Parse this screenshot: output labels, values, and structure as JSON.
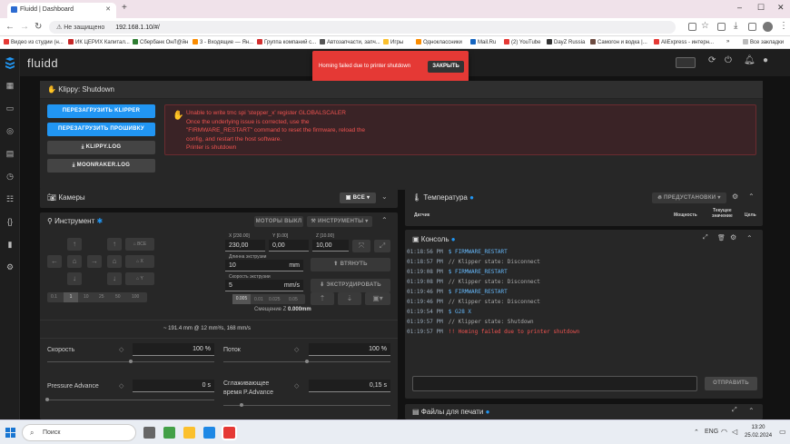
{
  "browser": {
    "tab_title": "Fluidd | Dashboard",
    "not_secure": "Не защищено",
    "url": "192.168.1.10/#/",
    "bookmarks": [
      {
        "label": "Видео из студии (н...",
        "color": "#e53935"
      },
      {
        "label": "ИК ЦЕРИХ Капитал...",
        "color": "#c62828"
      },
      {
        "label": "Сбербанк ОнЛ@йн",
        "color": "#2e7d32"
      },
      {
        "label": "3 - Входящие — Ян...",
        "color": "#fb8c00"
      },
      {
        "label": "Группа компаний с...",
        "color": "#d32f2f"
      },
      {
        "label": "Автозапчасти, запч...",
        "color": "#555"
      },
      {
        "label": "Игры",
        "color": "#fbc02d"
      },
      {
        "label": "Одноклассники",
        "color": "#fb8c00"
      },
      {
        "label": "Mail.Ru",
        "color": "#1565c0"
      },
      {
        "label": "(2) YouTube",
        "color": "#e53935"
      },
      {
        "label": "DayZ Russia",
        "color": "#333"
      },
      {
        "label": "Самогон и водка |...",
        "color": "#6d4c41"
      },
      {
        "label": "AliExpress - интерн...",
        "color": "#e53935"
      }
    ],
    "all_bookmarks": "Все закладки",
    "more": "»"
  },
  "app": {
    "brand": "fluidd",
    "accent": "#2196f3",
    "toast": {
      "message": "Homing failed due to printer shutdown",
      "close": "ЗАКРЫТЬ",
      "color": "#e53935"
    }
  },
  "klippy": {
    "title": "Klippy: Shutdown",
    "buttons": [
      "ПЕРЕЗАГРУЗИТЬ KLIPPER",
      "ПЕРЕЗАГРУЗИТЬ ПРОШИВКУ",
      "KLIPPY.LOG",
      "MOONRAKER.LOG"
    ],
    "error_lines": [
      "Unable to write tmc spi 'stepper_x' register GLOBALSCALER",
      "Once the underlying issue is corrected, use the",
      "\"FIRMWARE_RESTART\" command to reset the firmware, reload the",
      "config, and restart the host software.",
      "Printer is shutdown"
    ]
  },
  "cameras": {
    "title": "Камеры",
    "filter": "ВСЕ"
  },
  "tool": {
    "title": "Инструмент",
    "motors_off": "МОТОРЫ ВЫКЛ",
    "tools_menu": "ИНСТРУМЕНТЫ",
    "jog_all": "ВСЕ",
    "jog_x": "X",
    "jog_y": "Y",
    "steps": [
      "0.1",
      "1",
      "10",
      "25",
      "50",
      "100"
    ],
    "z_steps": [
      "0.005",
      "0.01",
      "0.025",
      "0.05"
    ],
    "x_label": "X [230.00]",
    "x_value": "230,00",
    "y_label": "Y [0.00]",
    "y_value": "0,00",
    "z_label": "Z [10.00]",
    "z_value": "10,00",
    "extrude_len_label": "Длинна экструзии",
    "extrude_len": "10",
    "extrude_len_unit": "mm",
    "extrude_speed_label": "Скорость экструзии",
    "extrude_speed": "5",
    "extrude_speed_unit": "mm/s",
    "retract": "ВТЯНУТЬ",
    "extrude": "ЭКСТРУДИРОВАТЬ",
    "z_offset_label": "Смещение Z",
    "z_offset": "0.000mm",
    "flow_summary": "~ 191.4 mm @ 12 mm³/s, 168 mm/s",
    "speed_label": "Скорость",
    "speed_value": "100 %",
    "flow_label": "Поток",
    "flow_value": "100 %",
    "pa_label": "Pressure Advance",
    "pa_value": "0 s",
    "smooth_label_1": "Сглаживающее",
    "smooth_label_2": "время P.Advance",
    "smooth_value": "0,15 s"
  },
  "temperature": {
    "title": "Температура",
    "presets": "ПРЕДУСТАНОВКИ",
    "col_sensor": "Датчик",
    "col_power": "Мощность",
    "col_current_1": "Текущее",
    "col_current_2": "значение",
    "col_target": "Цель"
  },
  "console": {
    "title": "Консоль",
    "send": "ОТПРАВИТЬ",
    "lines": [
      {
        "time": "01:18:56 PM",
        "text": "$ FIRMWARE_RESTART",
        "kind": "cmd"
      },
      {
        "time": "01:18:57 PM",
        "text": "// Klipper state: Disconnect",
        "kind": "info"
      },
      {
        "time": "01:19:08 PM",
        "text": "$ FIRMWARE_RESTART",
        "kind": "cmd"
      },
      {
        "time": "01:19:08 PM",
        "text": "// Klipper state: Disconnect",
        "kind": "info"
      },
      {
        "time": "01:19:46 PM",
        "text": "$ FIRMWARE_RESTART",
        "kind": "cmd"
      },
      {
        "time": "01:19:46 PM",
        "text": "// Klipper state: Disconnect",
        "kind": "info"
      },
      {
        "time": "01:19:54 PM",
        "text": "$ G28 X",
        "kind": "cmd"
      },
      {
        "time": "01:19:57 PM",
        "text": "// Klipper state: Shutdown",
        "kind": "info"
      },
      {
        "time": "01:19:57 PM",
        "text": "!! Homing failed due to printer shutdown",
        "kind": "err"
      }
    ]
  },
  "files": {
    "title": "Файлы для печати"
  },
  "taskbar": {
    "search": "Поиск",
    "lang": "ENG",
    "time": "13:20",
    "date": "25.02.2024"
  }
}
